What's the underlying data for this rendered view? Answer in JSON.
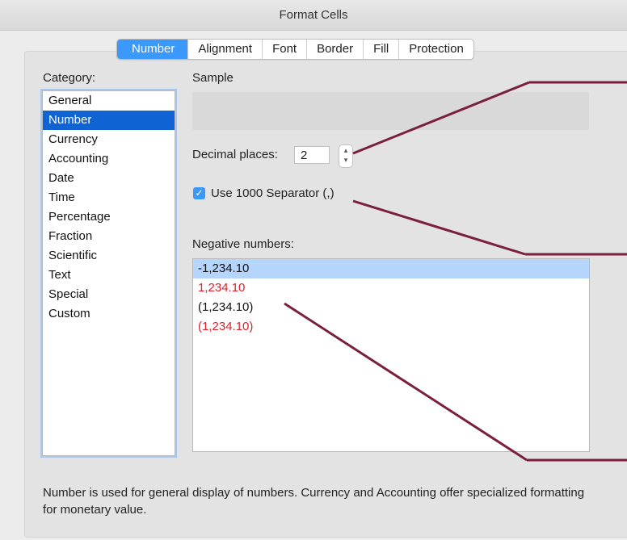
{
  "window": {
    "title": "Format Cells"
  },
  "tabs": [
    {
      "label": "Number",
      "active": true
    },
    {
      "label": "Alignment",
      "active": false
    },
    {
      "label": "Font",
      "active": false
    },
    {
      "label": "Border",
      "active": false
    },
    {
      "label": "Fill",
      "active": false
    },
    {
      "label": "Protection",
      "active": false
    }
  ],
  "category": {
    "label": "Category:",
    "selected": "Number",
    "items": [
      "General",
      "Number",
      "Currency",
      "Accounting",
      "Date",
      "Time",
      "Percentage",
      "Fraction",
      "Scientific",
      "Text",
      "Special",
      "Custom"
    ]
  },
  "sample": {
    "label": "Sample",
    "value": ""
  },
  "decimal_places": {
    "label": "Decimal places:",
    "value": "2"
  },
  "separator": {
    "label": "Use 1000 Separator (,)",
    "checked": true
  },
  "negative_numbers": {
    "label": "Negative numbers:",
    "items": [
      {
        "text": "-1,234.10",
        "color": "#111111",
        "selected": true
      },
      {
        "text": "1,234.10",
        "color": "#e0202a",
        "selected": false
      },
      {
        "text": "(1,234.10)",
        "color": "#111111",
        "selected": false
      },
      {
        "text": "(1,234.10)",
        "color": "#e0202a",
        "selected": false
      }
    ]
  },
  "description": "Number is used for general display of numbers.  Currency and Accounting offer specialized formatting for monetary value.",
  "colors": {
    "accent": "#3b99fc",
    "selection": "#0f63d3",
    "annotation_line": "#7a1f3d"
  }
}
